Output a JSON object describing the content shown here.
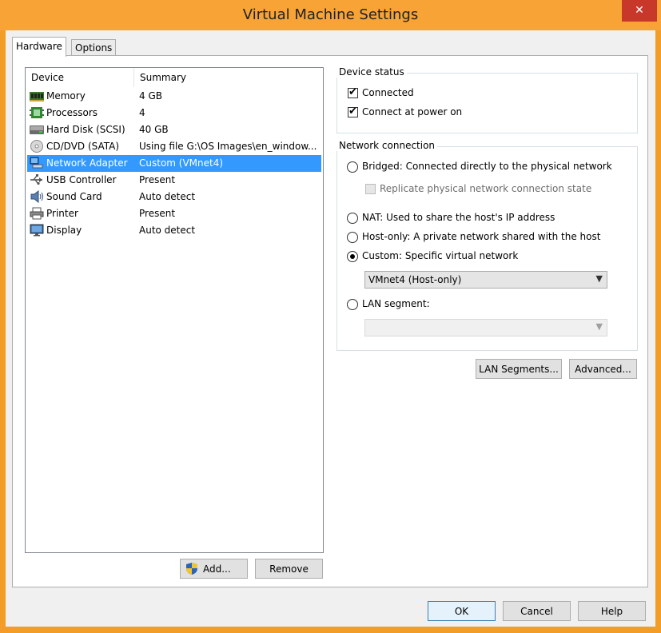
{
  "window": {
    "title": "Virtual Machine Settings",
    "close_glyph": "✕"
  },
  "tabs": [
    {
      "label": "Hardware",
      "active": true
    },
    {
      "label": "Options",
      "active": false
    }
  ],
  "devices": {
    "headers": {
      "device": "Device",
      "summary": "Summary"
    },
    "rows": [
      {
        "name": "Memory",
        "summary": "4 GB",
        "icon": "memory-icon"
      },
      {
        "name": "Processors",
        "summary": "4",
        "icon": "processor-icon"
      },
      {
        "name": "Hard Disk (SCSI)",
        "summary": "40 GB",
        "icon": "hard-disk-icon"
      },
      {
        "name": "CD/DVD (SATA)",
        "summary": "Using file G:\\OS Images\\en_window...",
        "icon": "cd-dvd-icon"
      },
      {
        "name": "Network Adapter",
        "summary": "Custom (VMnet4)",
        "icon": "network-adapter-icon",
        "selected": true
      },
      {
        "name": "USB Controller",
        "summary": "Present",
        "icon": "usb-icon"
      },
      {
        "name": "Sound Card",
        "summary": "Auto detect",
        "icon": "sound-card-icon"
      },
      {
        "name": "Printer",
        "summary": "Present",
        "icon": "printer-icon"
      },
      {
        "name": "Display",
        "summary": "Auto detect",
        "icon": "display-icon"
      }
    ],
    "add_label": "Add...",
    "remove_label": "Remove"
  },
  "device_status": {
    "title": "Device status",
    "connected": {
      "label": "Connected",
      "checked": true
    },
    "connect_power_on": {
      "label": "Connect at power on",
      "checked": true
    }
  },
  "network_connection": {
    "title": "Network connection",
    "bridged": {
      "label": "Bridged: Connected directly to the physical network",
      "selected": false
    },
    "replicate": {
      "label": "Replicate physical network connection state",
      "checked": false,
      "enabled": false
    },
    "nat": {
      "label": "NAT: Used to share the host's IP address",
      "selected": false
    },
    "hostonly": {
      "label": "Host-only: A private network shared with the host",
      "selected": false
    },
    "custom": {
      "label": "Custom: Specific virtual network",
      "selected": true
    },
    "custom_select_value": "VMnet4 (Host-only)",
    "lan_segment": {
      "label": "LAN segment:",
      "selected": false
    },
    "lan_select_value": ""
  },
  "buttons": {
    "lan_segments": "LAN Segments...",
    "advanced": "Advanced...",
    "ok": "OK",
    "cancel": "Cancel",
    "help": "Help"
  },
  "colors": {
    "titlebar": "#f7a335",
    "selection": "#3399ff",
    "close": "#c7382b"
  }
}
